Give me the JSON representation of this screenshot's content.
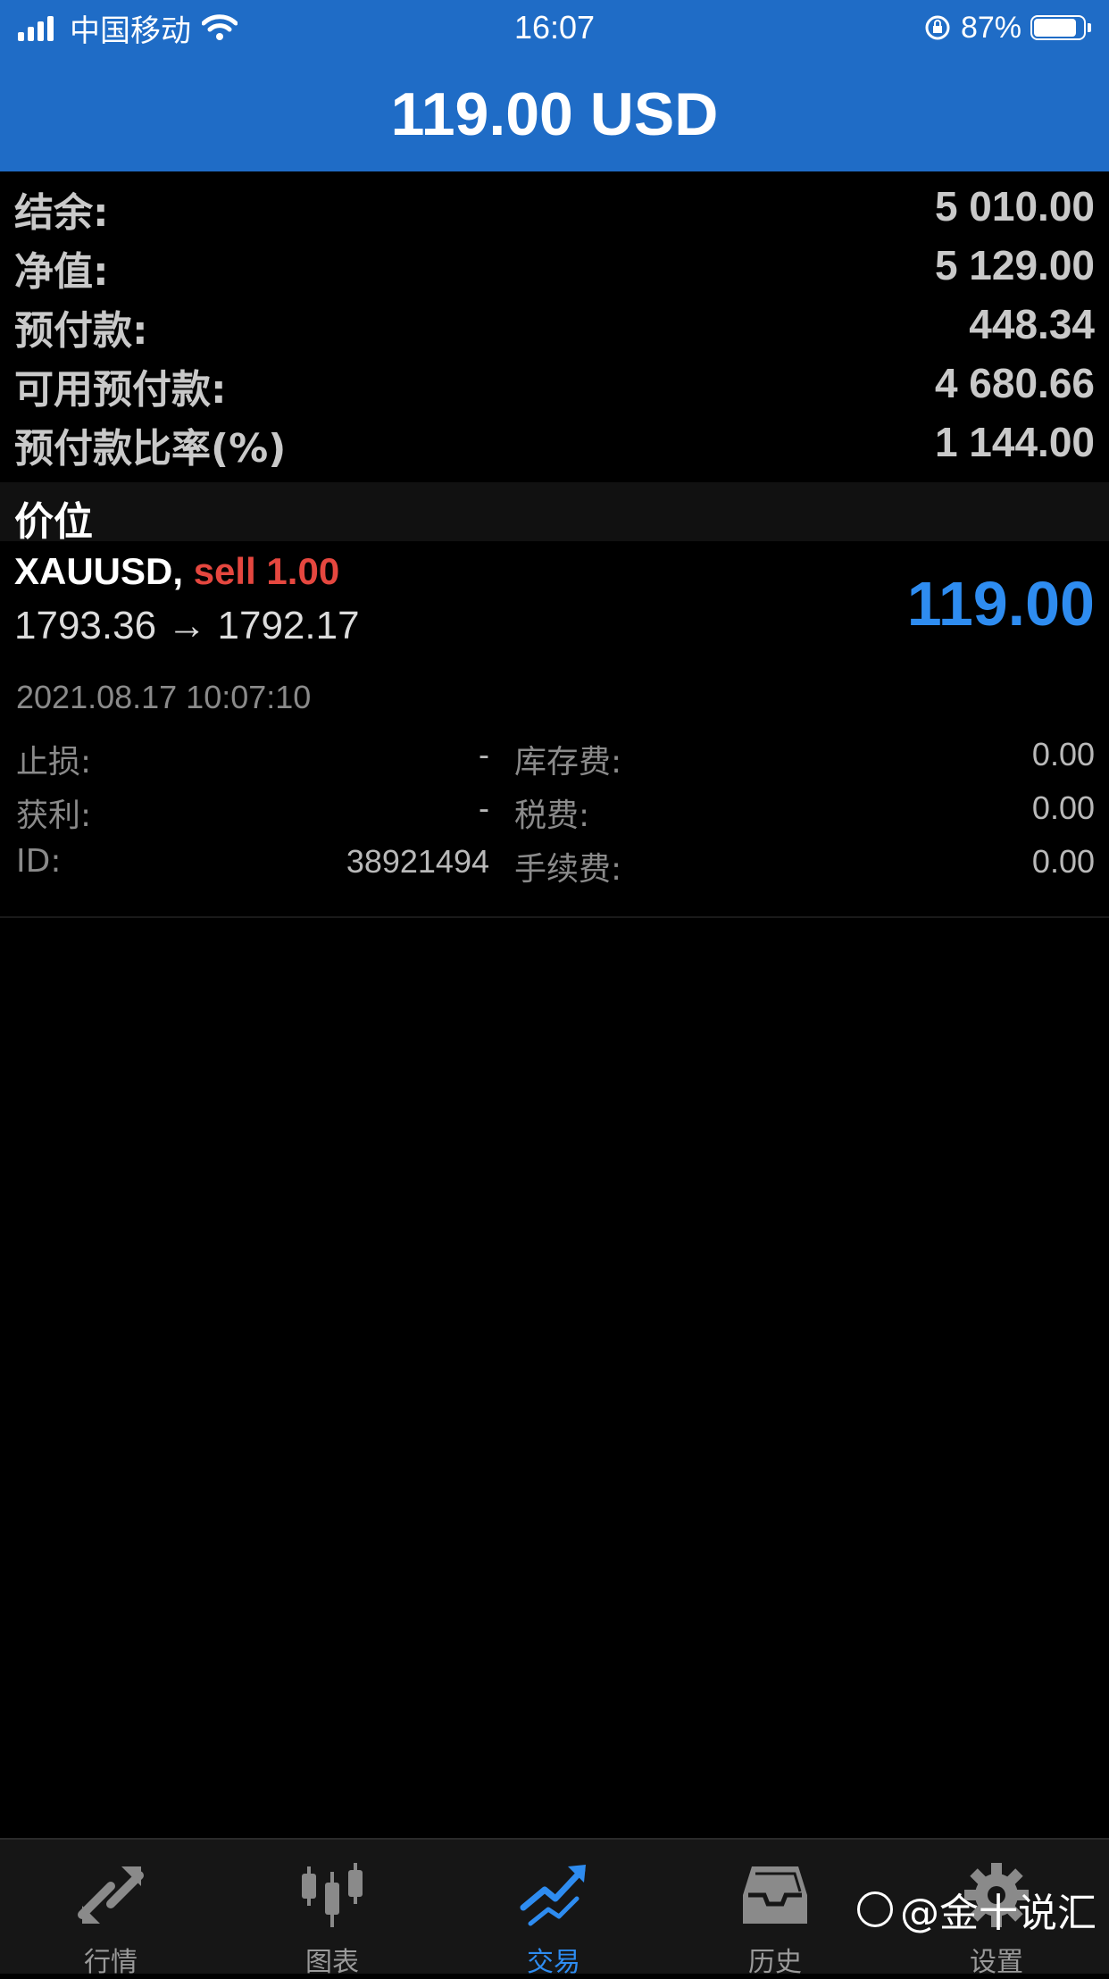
{
  "status_bar": {
    "carrier": "中国移动",
    "time": "16:07",
    "battery_percent": "87%",
    "battery_level": 0.87
  },
  "header": {
    "title": "119.00 USD"
  },
  "summary": [
    {
      "label": "结余:",
      "value": "5 010.00"
    },
    {
      "label": "净值:",
      "value": "5 129.00"
    },
    {
      "label": "预付款:",
      "value": "448.34"
    },
    {
      "label": "可用预付款:",
      "value": "4 680.66"
    },
    {
      "label": "预付款比率(%)",
      "value": "1 144.00"
    }
  ],
  "section": {
    "title": "价位"
  },
  "position": {
    "symbol": "XAUUSD,",
    "side": "sell 1.00",
    "prices": "1793.36 → 1792.17",
    "profit": "119.00",
    "open_time": "2021.08.17 10:07:10",
    "details": [
      {
        "l1": "止损:",
        "v1": "-",
        "l2": "库存费:",
        "v2": "0.00"
      },
      {
        "l1": "获利:",
        "v1": "-",
        "l2": "税费:",
        "v2": "0.00"
      },
      {
        "l1": "ID:",
        "v1": "38921494",
        "l2": "手续费:",
        "v2": "0.00"
      }
    ]
  },
  "tabs": [
    {
      "label": "行情",
      "icon": "quotes-arrows-icon",
      "active": false
    },
    {
      "label": "图表",
      "icon": "candlestick-chart-icon",
      "active": false
    },
    {
      "label": "交易",
      "icon": "trade-trend-icon",
      "active": true
    },
    {
      "label": "历史",
      "icon": "history-inbox-icon",
      "active": false
    },
    {
      "label": "设置",
      "icon": "gear-icon",
      "active": false
    }
  ],
  "watermark": "@金十说汇",
  "colors": {
    "header_blue": "#1f6cc6",
    "profit_blue": "#2e8cf0",
    "sell_red": "#e5473f"
  }
}
